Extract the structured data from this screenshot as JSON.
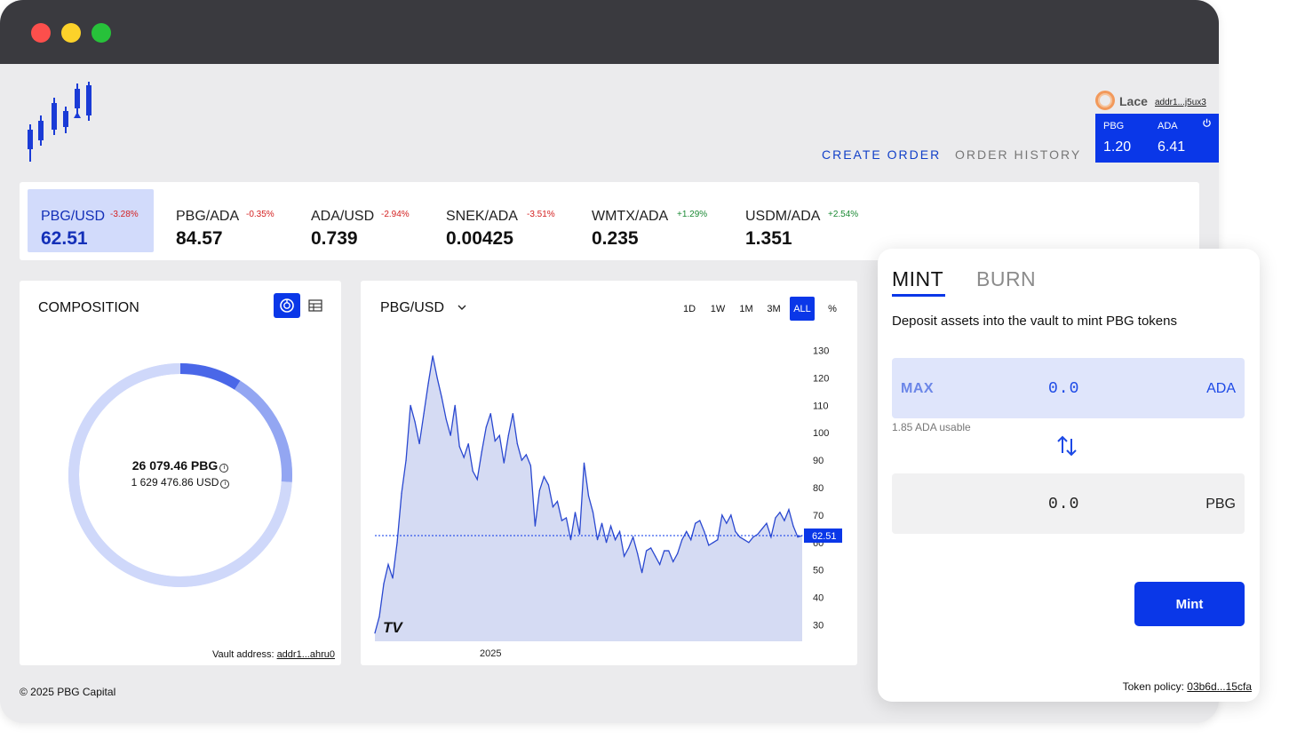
{
  "window": {
    "controls": [
      "close",
      "minimize",
      "maximize"
    ]
  },
  "logo": {
    "icon": "candlestick-logo-icon"
  },
  "nav": {
    "create_order": "CREATE ORDER",
    "order_history": "ORDER HISTORY"
  },
  "wallet": {
    "name": "Lace",
    "address": "addr1...j5ux3",
    "token1_label": "PBG",
    "token1_value": "1.20",
    "token2_label": "ADA",
    "token2_value": "6.41",
    "power_icon": "power-icon"
  },
  "tickers": [
    {
      "pair": "PBG/USD",
      "change": "-3.28%",
      "price": "62.51",
      "direction": "neg",
      "active": true
    },
    {
      "pair": "PBG/ADA",
      "change": "-0.35%",
      "price": "84.57",
      "direction": "neg",
      "active": false
    },
    {
      "pair": "ADA/USD",
      "change": "-2.94%",
      "price": "0.739",
      "direction": "neg",
      "active": false
    },
    {
      "pair": "SNEK/ADA",
      "change": "-3.51%",
      "price": "0.00425",
      "direction": "neg",
      "active": false
    },
    {
      "pair": "WMTX/ADA",
      "change": "+1.29%",
      "price": "0.235",
      "direction": "pos",
      "active": false
    },
    {
      "pair": "USDM/ADA",
      "change": "+2.54%",
      "price": "1.351",
      "direction": "pos",
      "active": false
    }
  ],
  "composition": {
    "title": "COMPOSITION",
    "total_pbg": "26 079.46 PBG",
    "total_usd": "1 629 476.86 USD",
    "vault_label": "Vault address: ",
    "vault_address": "addr1...ahru0",
    "segments": [
      {
        "share": 0.09,
        "color": "#4a67e8"
      },
      {
        "share": 0.17,
        "color": "#93a6f2"
      },
      {
        "share": 0.74,
        "color": "#cfd8fa"
      }
    ]
  },
  "chart": {
    "pair": "PBG/USD",
    "timeframes": [
      "1D",
      "1W",
      "1M",
      "3M",
      "ALL",
      "%"
    ],
    "active_timeframe": "ALL",
    "x_label": "2025",
    "y_ticks": [
      "130",
      "120",
      "110",
      "100",
      "90",
      "80",
      "70",
      "60",
      "50",
      "40",
      "30"
    ],
    "last_price_label": "62.51",
    "watermark": "TV",
    "colors": {
      "line": "#2a48d0",
      "fill": "#d5dbf3",
      "price_tag": "#0a37e8"
    }
  },
  "chart_data": {
    "type": "area",
    "title": "PBG/USD",
    "xlabel": "",
    "ylabel": "",
    "ylim": [
      24,
      136
    ],
    "last_value": 62.51,
    "x": [
      "t0",
      "t1",
      "t2",
      "t3",
      "t4",
      "t5",
      "t6",
      "t7",
      "t8",
      "t9",
      "t10",
      "t11",
      "t12",
      "t13",
      "t14",
      "t15",
      "t16",
      "t17",
      "t18",
      "t19",
      "t20",
      "t21",
      "t22",
      "t23",
      "t24",
      "t25",
      "t26",
      "t27",
      "t28",
      "t29",
      "t30",
      "t31",
      "t32",
      "t33",
      "t34",
      "t35",
      "t36",
      "t37",
      "t38",
      "t39",
      "t40",
      "t41",
      "t42",
      "t43",
      "t44",
      "t45",
      "t46",
      "t47",
      "t48",
      "t49",
      "t50",
      "t51",
      "t52",
      "t53",
      "t54",
      "t55",
      "t56",
      "t57",
      "t58",
      "t59",
      "t60",
      "t61",
      "t62",
      "t63",
      "t64",
      "t65",
      "t66",
      "t67",
      "t68",
      "t69",
      "t70",
      "t71",
      "t72",
      "t73",
      "t74",
      "t75",
      "t76",
      "t77",
      "t78",
      "t79",
      "t80",
      "t81",
      "t82",
      "t83",
      "t84",
      "t85",
      "t86",
      "t87",
      "t88",
      "t89",
      "t90",
      "t91",
      "t92",
      "t93",
      "t94",
      "t95",
      "t96"
    ],
    "series": [
      {
        "name": "PBG/USD",
        "values": [
          27,
          33,
          45,
          52,
          47,
          60,
          78,
          90,
          110,
          104,
          96,
          107,
          118,
          128,
          120,
          113,
          105,
          99,
          110,
          95,
          91,
          96,
          86,
          83,
          93,
          102,
          107,
          97,
          99,
          89,
          99,
          107,
          96,
          90,
          92,
          88,
          66,
          79,
          84,
          81,
          73,
          75,
          68,
          69,
          61,
          71,
          63,
          89,
          77,
          71,
          61,
          67,
          60,
          66,
          61,
          64,
          55,
          58,
          62,
          56,
          49,
          57,
          58,
          55,
          52,
          57,
          57,
          53,
          56,
          61,
          64,
          61,
          67,
          68,
          64,
          59,
          60,
          61,
          70,
          67,
          70,
          64,
          62,
          61,
          60,
          62,
          63,
          65,
          67,
          62,
          69,
          71,
          68,
          72,
          66,
          62,
          62.51
        ]
      }
    ]
  },
  "footer": {
    "copyright": "© 2025 PBG Capital"
  },
  "panel": {
    "tab_mint": "MINT",
    "tab_burn": "BURN",
    "description": "Deposit assets into the vault to mint PBG tokens",
    "input_max": "MAX",
    "input_value": "0.0",
    "input_unit": "ADA",
    "usable": "1.85 ADA usable",
    "output_value": "0.0",
    "output_unit": "PBG",
    "mint_button": "Mint",
    "policy_label": "Token policy: ",
    "policy_id": "03b6d...15cfa"
  }
}
